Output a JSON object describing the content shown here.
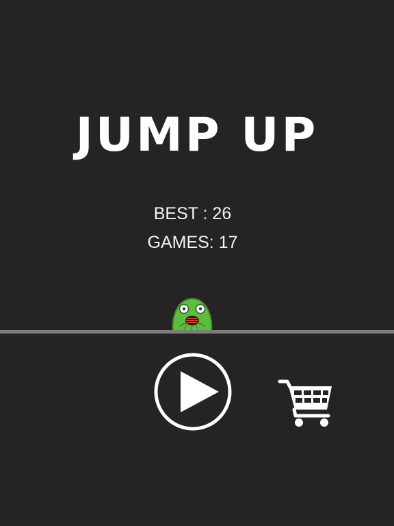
{
  "game": {
    "title": "JUMP UP",
    "stats": {
      "best": "BEST : 26",
      "games": "GAMES: 17"
    }
  },
  "controls": {
    "play_icon": "play-icon",
    "cart_icon": "shopping-cart-icon"
  },
  "colors": {
    "background": "#252324",
    "ground": "#7d7d7d",
    "text": "#ffffff",
    "character_green": "#5fbd3e"
  }
}
